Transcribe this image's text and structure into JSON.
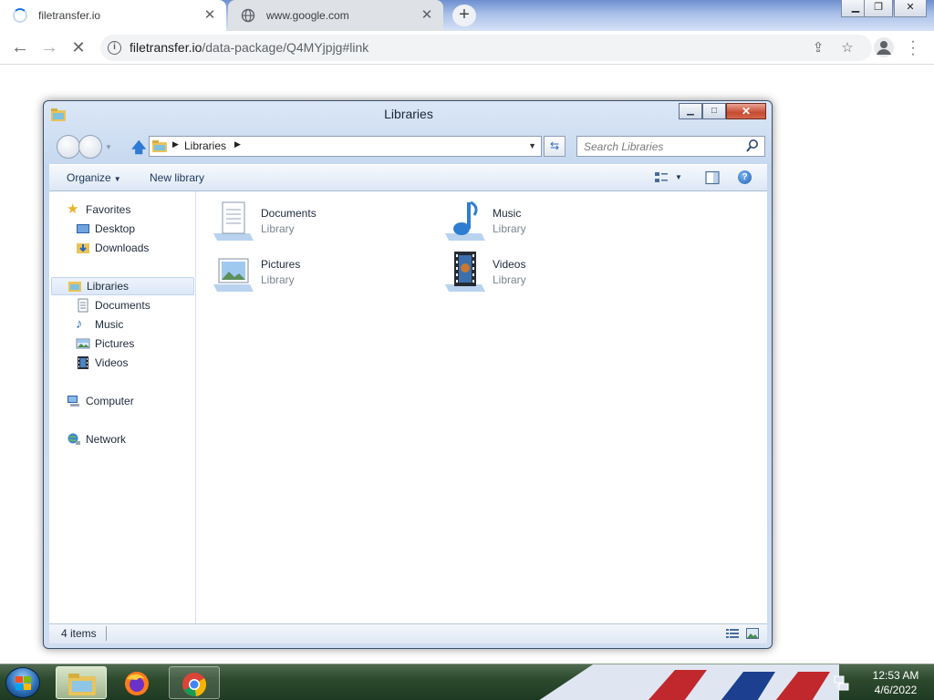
{
  "browser": {
    "tabs": [
      {
        "title": "filetransfer.io",
        "state": "loading"
      },
      {
        "title": "www.google.com"
      }
    ],
    "new_tab_label": "+",
    "url_host": "filetransfer.io",
    "url_path": "/data-package/Q4MYjpjg#link",
    "colors": {
      "accent": "#1a73e8",
      "toolbar": "#ffffff",
      "omnibox": "#f1f3f4"
    }
  },
  "explorer": {
    "title": "Libraries",
    "breadcrumb": [
      "Libraries"
    ],
    "search_placeholder": "Search Libraries",
    "commands": {
      "organize": "Organize",
      "new_library": "New library"
    },
    "nav": {
      "favorites": {
        "label": "Favorites",
        "items": [
          "Desktop",
          "Downloads"
        ]
      },
      "libraries": {
        "label": "Libraries",
        "items": [
          "Documents",
          "Music",
          "Pictures",
          "Videos"
        ]
      },
      "computer": "Computer",
      "network": "Network"
    },
    "libraries": [
      {
        "name": "Documents",
        "type": "Library",
        "icon": "documents-library-icon"
      },
      {
        "name": "Music",
        "type": "Library",
        "icon": "music-library-icon"
      },
      {
        "name": "Pictures",
        "type": "Library",
        "icon": "pictures-library-icon"
      },
      {
        "name": "Videos",
        "type": "Library",
        "icon": "videos-library-icon"
      }
    ],
    "status": "4 items"
  },
  "taskbar": {
    "time": "12:53 AM",
    "date": "4/6/2022",
    "pinned": [
      "windows-explorer",
      "firefox",
      "chrome"
    ]
  }
}
